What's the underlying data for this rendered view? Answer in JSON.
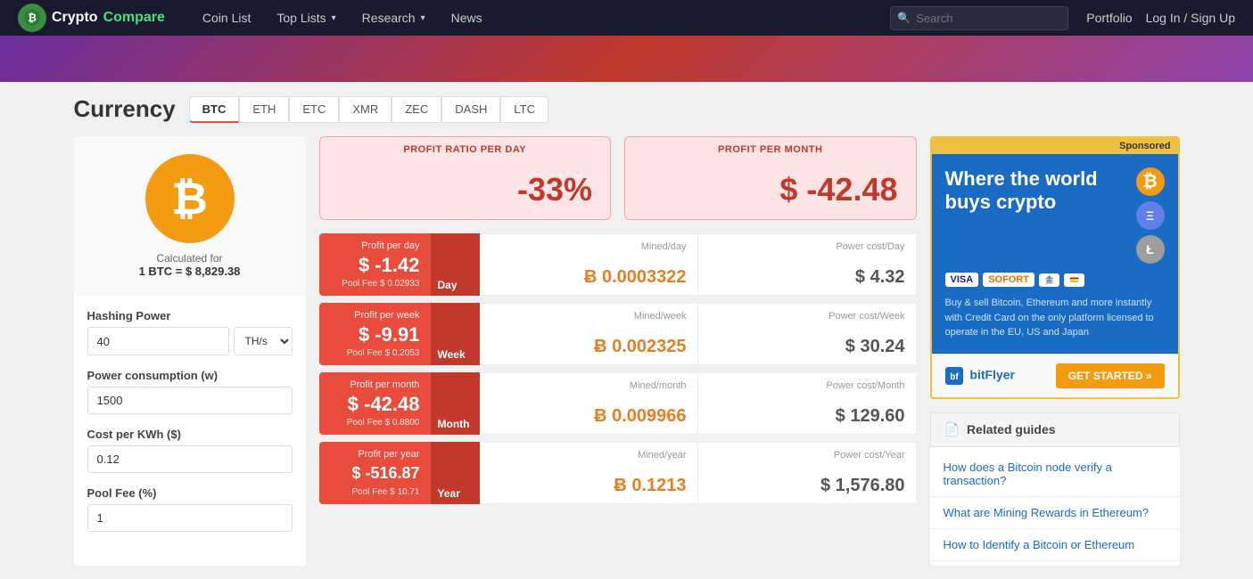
{
  "navbar": {
    "brand": "CryptoCompare",
    "brand_crypto": "Crypto",
    "brand_compare": "Compare",
    "nav_items": [
      {
        "label": "Coin List",
        "has_dropdown": false
      },
      {
        "label": "Top Lists",
        "has_dropdown": true
      },
      {
        "label": "Research",
        "has_dropdown": true
      },
      {
        "label": "News",
        "has_dropdown": false
      }
    ],
    "search_placeholder": "Search",
    "portfolio_label": "Portfolio",
    "auth_label": "Log In / Sign Up"
  },
  "currency": {
    "title": "Currency",
    "tabs": [
      "BTC",
      "ETH",
      "ETC",
      "XMR",
      "ZEC",
      "DASH",
      "LTC"
    ],
    "active_tab": "BTC"
  },
  "coin": {
    "symbol": "₿",
    "calc_label": "Calculated for",
    "calc_value": "1 BTC = $ 8,829.38"
  },
  "inputs": {
    "hashing_power_label": "Hashing Power",
    "hashing_power_value": "40",
    "hashing_power_unit": "TH/s",
    "power_consumption_label": "Power consumption (w)",
    "power_consumption_value": "1500",
    "cost_per_kwh_label": "Cost per KWh ($)",
    "cost_per_kwh_value": "0.12",
    "pool_fee_label": "Pool Fee (%)",
    "pool_fee_value": "1"
  },
  "profit_summary": {
    "ratio_label": "PROFIT RATIO PER DAY",
    "ratio_value": "-33%",
    "month_label": "PROFIT PER MONTH",
    "month_value": "$ -42.48"
  },
  "mining_rows": [
    {
      "period": "Day",
      "profit_label": "Profit per day",
      "profit_value": "$ -1.42",
      "pool_fee": "Pool Fee $ 0.02933",
      "mined_label": "Mined/day",
      "mined_value": "Ƀ 0.0003322",
      "power_label": "Power cost/Day",
      "power_value": "$ 4.32"
    },
    {
      "period": "Week",
      "profit_label": "Profit per week",
      "profit_value": "$ -9.91",
      "pool_fee": "Pool Fee $ 0.2053",
      "mined_label": "Mined/week",
      "mined_value": "Ƀ 0.002325",
      "power_label": "Power cost/Week",
      "power_value": "$ 30.24"
    },
    {
      "period": "Month",
      "profit_label": "Profit per month",
      "profit_value": "$ -42.48",
      "pool_fee": "Pool Fee $ 0.8800",
      "mined_label": "Mined/month",
      "mined_value": "Ƀ 0.009966",
      "power_label": "Power cost/Month",
      "power_value": "$ 129.60"
    },
    {
      "period": "Year",
      "profit_label": "Profit per year",
      "profit_value": "$ -516.87",
      "pool_fee": "Pool Fee $ 10.71",
      "mined_label": "Mined/year",
      "mined_value": "Ƀ 0.1213",
      "power_label": "Power cost/Year",
      "power_value": "$ 1,576.80"
    }
  ],
  "sponsor": {
    "tag": "Sponsored",
    "headline": "Where the world buys crypto",
    "desc": "Buy & sell Bitcoin, Ethereum and more instantly with Credit Card on the only platform licensed to operate in the EU, US and Japan",
    "logos": [
      "VISA",
      "SOFORT"
    ],
    "cta": "GET STARTED »",
    "brand": "bitFlyer"
  },
  "related_guides": {
    "title": "Related guides",
    "items": [
      "How does a Bitcoin node verify a transaction?",
      "What are Mining Rewards in Ethereum?",
      "How to Identify a Bitcoin or Ethereum"
    ]
  }
}
